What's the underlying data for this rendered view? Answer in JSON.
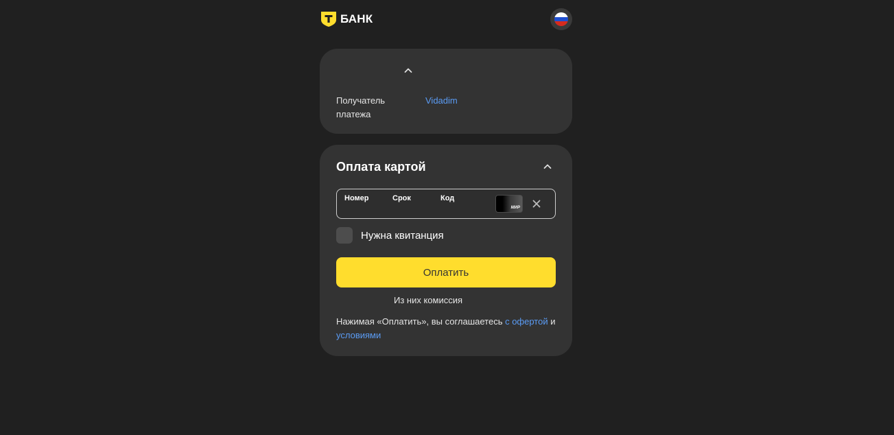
{
  "header": {
    "logo_text": "БАНК",
    "logo_mark": "Т",
    "language_flag": "russia-flag-icon",
    "brand_color": "#ffdd2d"
  },
  "recipient_card": {
    "toggle_icon": "chevron-up-icon",
    "label": "Получатель платежа",
    "value": "Vidadim"
  },
  "payment_card": {
    "title": "Оплата картой",
    "toggle_icon": "chevron-up-icon",
    "card_input": {
      "number_label": "Номер",
      "expiry_label": "Срок",
      "cvc_label": "Код",
      "payment_system": "МИР",
      "clear_icon": "close-icon"
    },
    "receipt_checkbox": {
      "label": "Нужна квитанция",
      "checked": false
    },
    "pay_button_label": "Оплатить",
    "commission_text": "Из них комиссия",
    "terms": {
      "prefix": "Нажимая «Оплатить», вы соглашаетесь ",
      "offer_link": "с офертой",
      "middle": " и ",
      "conditions_link": "условиями"
    }
  },
  "colors": {
    "background": "#202020",
    "card": "#333333",
    "link": "#5b9cf5",
    "accent": "#ffdd2d"
  }
}
